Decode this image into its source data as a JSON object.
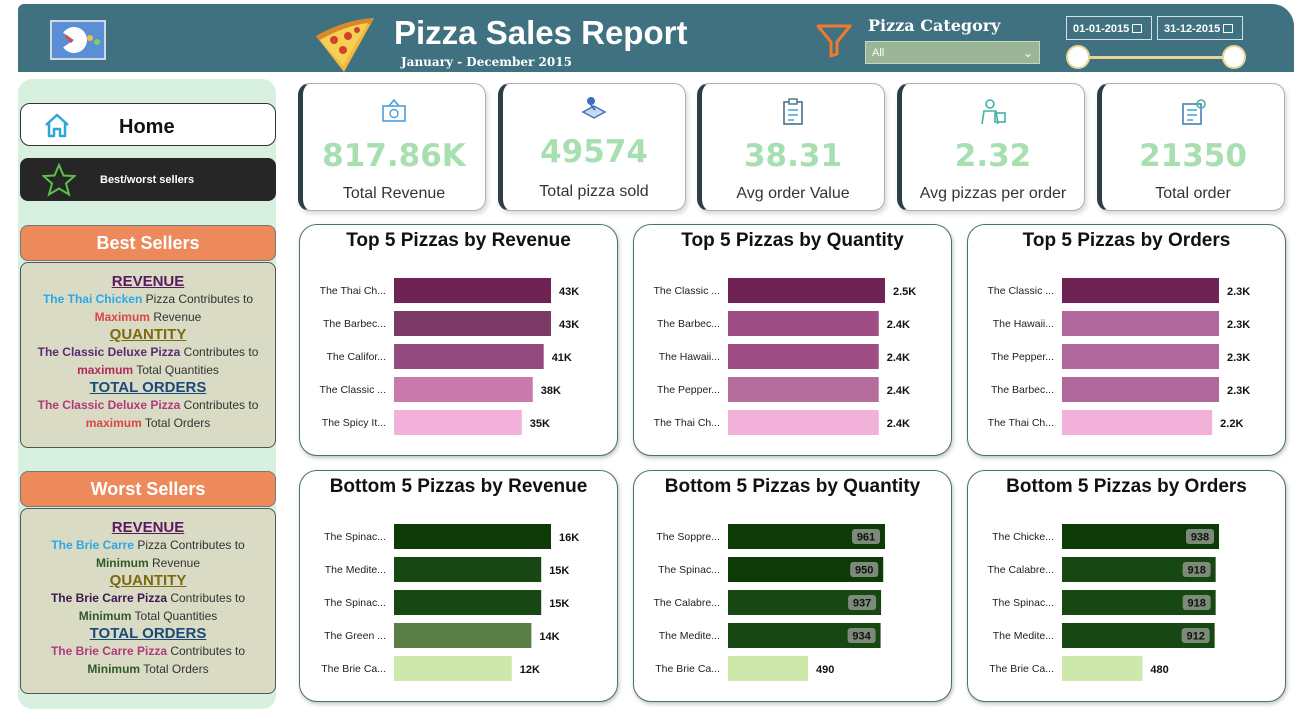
{
  "header": {
    "title": "Pizza Sales Report",
    "subtitle": "January - December 2015",
    "category_label": "Pizza Category",
    "category_value": "All",
    "date_start": "01-01-2015",
    "date_end": "31-12-2015"
  },
  "sidebar": {
    "home_label": "Home",
    "best_worst_label": "Best/worst sellers",
    "best": {
      "title": "Best Sellers",
      "revenue_head": "REVENUE",
      "revenue_name": "The Thai Chicken",
      "revenue_mid": " Pizza Contributes to",
      "revenue_strong": "Maximum",
      "revenue_tail": " Revenue",
      "quantity_head": "QUANTITY",
      "quantity_name": "The Classic Deluxe Pizza",
      "quantity_mid": " Contributes to",
      "quantity_strong": "maximum",
      "quantity_tail": " Total Quantities",
      "orders_head": "TOTAL ORDERS",
      "orders_name": "The Classic Deluxe Pizza",
      "orders_mid": " Contributes to",
      "orders_strong": "maximum",
      "orders_tail": " Total Orders"
    },
    "worst": {
      "title": "Worst Sellers",
      "revenue_head": "REVENUE",
      "revenue_name": "The Brie Carre",
      "revenue_mid": " Pizza Contributes to",
      "revenue_strong": "Minimum",
      "revenue_tail": " Revenue",
      "quantity_head": "QUANTITY",
      "quantity_name": "The Brie Carre  Pizza",
      "quantity_mid": " Contributes to",
      "quantity_strong": "Minimum",
      "quantity_tail": " Total Quantities",
      "orders_head": "TOTAL ORDERS",
      "orders_name": "The Brie Carre Pizza",
      "orders_mid": " Contributes to",
      "orders_strong": "Minimum",
      "orders_tail": " Total Orders"
    }
  },
  "kpis": [
    {
      "value": "817.86K",
      "label": "Total Revenue",
      "icon": "revenue-icon"
    },
    {
      "value": "49574",
      "label": "Total pizza sold",
      "icon": "pizza-sold-icon"
    },
    {
      "value": "38.31",
      "label": "Avg order Value",
      "icon": "clipboard-icon"
    },
    {
      "value": "2.32",
      "label": "Avg pizzas per order",
      "icon": "delivery-icon"
    },
    {
      "value": "21350",
      "label": "Total order",
      "icon": "orders-icon"
    }
  ],
  "colors": {
    "header_bg": "#3f7180",
    "kpi_value": "#a8dfb0",
    "best_header": "#ec8a5c"
  },
  "chart_data": [
    {
      "type": "bar",
      "title": "Top 5 Pizzas by Revenue",
      "categories": [
        "The Thai Ch...",
        "The Barbec...",
        "The Califor...",
        "The Classic ...",
        "The Spicy It..."
      ],
      "values": [
        43,
        43,
        41,
        38,
        35
      ],
      "labels": [
        "43K",
        "43K",
        "41K",
        "38K",
        "35K"
      ],
      "colors": [
        "#6e2354",
        "#7c3a67",
        "#934a7e",
        "#c77aab",
        "#f1b1d9"
      ],
      "xlim": [
        0,
        43
      ],
      "label_style": "outside"
    },
    {
      "type": "bar",
      "title": "Top 5 Pizzas by Quantity",
      "categories": [
        "The Classic ...",
        "The Barbec...",
        "The Hawaii...",
        "The Pepper...",
        "The Thai Ch..."
      ],
      "values": [
        2.5,
        2.4,
        2.4,
        2.4,
        2.4
      ],
      "labels": [
        "2.5K",
        "2.4K",
        "2.4K",
        "2.4K",
        "2.4K"
      ],
      "colors": [
        "#6e2354",
        "#9e4e85",
        "#9e4e85",
        "#b56d9c",
        "#f1b1d9"
      ],
      "xlim": [
        0,
        2.5
      ],
      "label_style": "outside"
    },
    {
      "type": "bar",
      "title": "Top 5 Pizzas by Orders",
      "categories": [
        "The Classic ...",
        "The Hawaii...",
        "The Pepper...",
        "The Barbec...",
        "The Thai Ch..."
      ],
      "values": [
        2.3,
        2.3,
        2.3,
        2.3,
        2.2
      ],
      "labels": [
        "2.3K",
        "2.3K",
        "2.3K",
        "2.3K",
        "2.2K"
      ],
      "colors": [
        "#6e2354",
        "#b0679b",
        "#b0679b",
        "#b0679b",
        "#f1b1d9"
      ],
      "xlim": [
        0,
        2.3
      ],
      "label_style": "outside"
    },
    {
      "type": "bar",
      "title": "Bottom 5 Pizzas by Revenue",
      "categories": [
        "The Spinac...",
        "The Medite...",
        "The Spinac...",
        "The Green ...",
        "The Brie Ca..."
      ],
      "values": [
        16,
        15,
        15,
        14,
        12
      ],
      "labels": [
        "16K",
        "15K",
        "15K",
        "14K",
        "12K"
      ],
      "colors": [
        "#0e3a08",
        "#174712",
        "#174712",
        "#5a7e45",
        "#cde8aa"
      ],
      "xlim": [
        0,
        16
      ],
      "label_style": "outside"
    },
    {
      "type": "bar",
      "title": "Bottom 5 Pizzas by Quantity",
      "categories": [
        "The Soppre...",
        "The Spinac...",
        "The Calabre...",
        "The Medite...",
        "The Brie Ca..."
      ],
      "values": [
        961,
        950,
        937,
        934,
        490
      ],
      "labels": [
        "961",
        "950",
        "937",
        "934",
        "490"
      ],
      "colors": [
        "#0e3a08",
        "#0e3a08",
        "#174712",
        "#174712",
        "#cde8aa"
      ],
      "xlim": [
        0,
        961
      ],
      "label_style": "inside_except_last"
    },
    {
      "type": "bar",
      "title": "Bottom 5 Pizzas by Orders",
      "categories": [
        "The Chicke...",
        "The Calabre...",
        "The Spinac...",
        "The Medite...",
        "The Brie Ca..."
      ],
      "values": [
        938,
        918,
        918,
        912,
        480
      ],
      "labels": [
        "938",
        "918",
        "918",
        "912",
        "480"
      ],
      "colors": [
        "#0e3a08",
        "#174712",
        "#174712",
        "#174712",
        "#cde8aa"
      ],
      "xlim": [
        0,
        938
      ],
      "label_style": "inside_except_last"
    }
  ]
}
